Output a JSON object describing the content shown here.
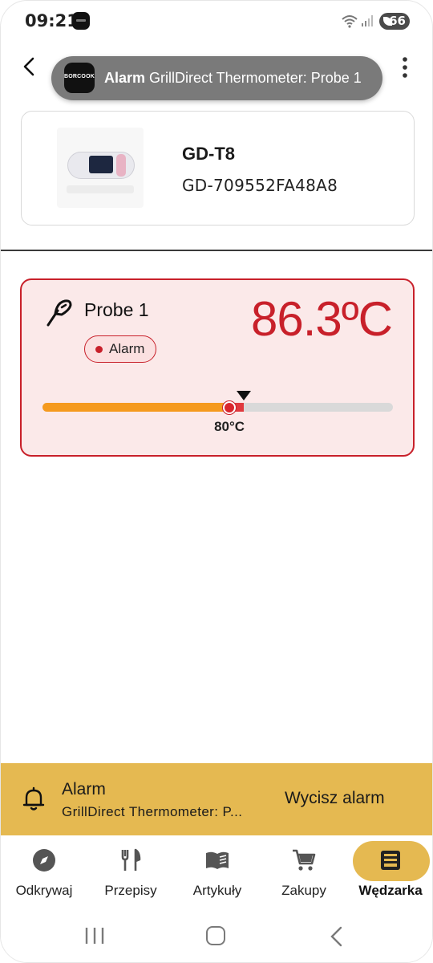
{
  "status_bar": {
    "time": "09:21",
    "battery": "66"
  },
  "notification": {
    "app_icon_text": "BORCOOK",
    "title": "Alarm",
    "text": "GrillDirect Thermometer: Probe 1"
  },
  "device": {
    "name": "GD-T8",
    "id": "GD-709552FA48A8"
  },
  "probe": {
    "label": "Probe 1",
    "temperature": "86.3ºC",
    "status": "Alarm",
    "target_label": "80°C",
    "scale_min_c": 0,
    "scale_max_c": 150,
    "target_c": 80,
    "current_c": 86.3
  },
  "alarm_banner": {
    "title": "Alarm",
    "text": "GrillDirect Thermometer: P...",
    "button": "Wycisz alarm"
  },
  "bottom_nav": {
    "items": [
      {
        "label": "Odkrywaj",
        "icon": "compass-icon",
        "active": false
      },
      {
        "label": "Przepisy",
        "icon": "cutlery-icon",
        "active": false
      },
      {
        "label": "Artykuły",
        "icon": "book-icon",
        "active": false
      },
      {
        "label": "Zakupy",
        "icon": "cart-icon",
        "active": false
      },
      {
        "label": "Wędzarka",
        "icon": "smoker-icon",
        "active": true
      }
    ]
  },
  "colors": {
    "alarm_red": "#c8202a",
    "alarm_bg": "#fbe9e9",
    "accent_yellow": "#e5b951",
    "bar_orange": "#f59a1e"
  }
}
